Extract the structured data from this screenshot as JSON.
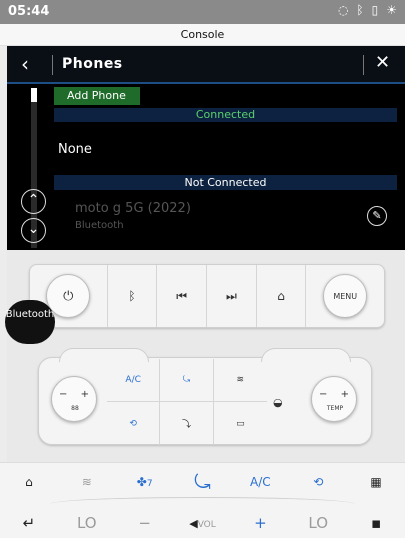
{
  "status_bar": {
    "time": "05:44",
    "icons": [
      "wifi-icon",
      "bluetooth-icon",
      "battery-icon",
      "brightness-icon"
    ]
  },
  "app_title": "Console",
  "phones_panel": {
    "title": "Phones",
    "add_phone_label": "Add Phone",
    "connected_label": "Connected",
    "connected_device": "None",
    "not_connected_label": "Not Connected",
    "devices": [
      {
        "name": "moto g 5G (2022)",
        "type": "Bluetooth"
      }
    ]
  },
  "controls": {
    "tooltip": "Bluetooth",
    "menu_label": "MENU"
  },
  "climate": {
    "ac_label": "A/C",
    "temp_label": "TEMP",
    "fan_label": "88"
  },
  "bottom_nav": {
    "ac_label": "A/C",
    "fan_speed": "7",
    "left_temp": "LO",
    "right_temp": "LO",
    "vol_label": "VOL"
  },
  "colors": {
    "accent_blue": "#2a6fd0",
    "connected_green": "#5ad06d",
    "add_phone_bg": "#1f6b2a"
  }
}
